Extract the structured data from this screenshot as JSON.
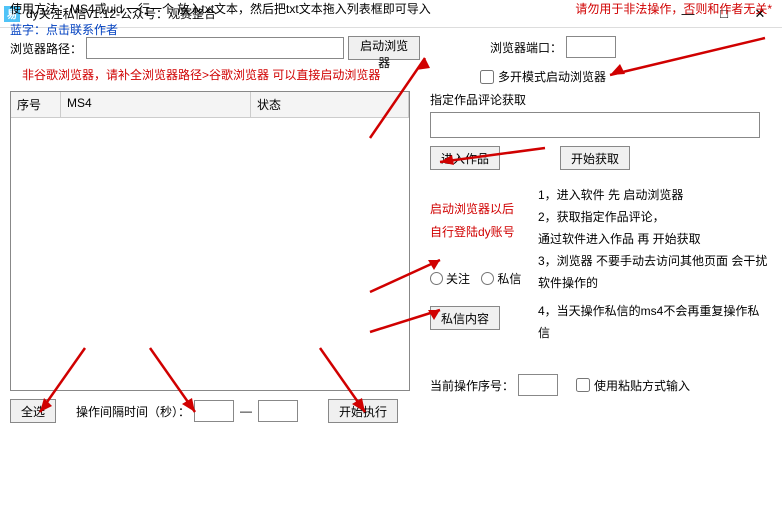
{
  "titlebar": {
    "icon_letter": "易",
    "title": "dy关注私信v1.12-公众号：观赛整合"
  },
  "left": {
    "browser_path_label": "浏览器路径：",
    "browser_path_value": "",
    "start_browser_btn": "启动浏览器",
    "hint_red": "非谷歌浏览器，请补全浏览器路径>谷歌浏览器 可以直接启动浏览器",
    "table": {
      "cols": [
        "序号",
        "MS4",
        "状态"
      ]
    },
    "select_all_btn": "全选",
    "interval_label": "操作间隔时间（秒）：",
    "interval_from": "",
    "interval_to": "",
    "dash": "—",
    "start_exec_btn": "开始执行"
  },
  "right": {
    "port_label": "浏览器端口：",
    "port_value": "",
    "multi_open_label": "多开模式启动浏览器",
    "fetch_label": "指定作品评论获取",
    "fetch_value": "",
    "enter_work_btn": "进入作品",
    "start_fetch_btn": "开始获取",
    "instr1": "1，进入软件 先 启动浏览器",
    "instr2": "2，获取指定作品评论，",
    "instr2b": "通过软件进入作品 再 开始获取",
    "instr3": "3，浏览器 不要手动去访问其他页面 会干扰软件操作的",
    "instr4": "4，当天操作私信的ms4不会再重复操作私信",
    "radio_follow": "关注",
    "radio_dm": "私信",
    "dm_content_btn": "私信内容",
    "red_note1": "启动浏览器以后",
    "red_note2": "自行登陆dy账号",
    "cur_index_label": "当前操作序号：",
    "cur_index_value": "",
    "paste_mode_label": "使用粘贴方式输入"
  },
  "footer": {
    "usage": "使用方法：MS4或uid 一行一个 放入txt文本，然后把txt文本拖入列表框即可导入",
    "blue_note": "蓝字：点击联系作者",
    "warning": "请勿用于非法操作，否则和作者无关*"
  }
}
